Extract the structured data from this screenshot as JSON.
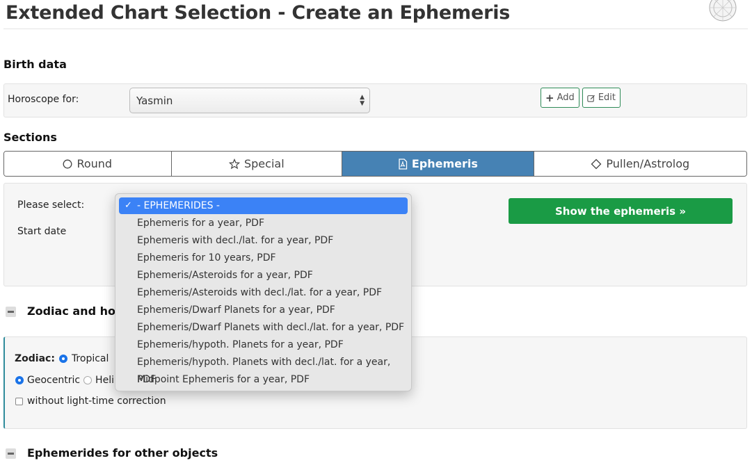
{
  "page": {
    "title": "Extended Chart Selection - Create an Ephemeris"
  },
  "birth": {
    "heading": "Birth data",
    "horoscope_label": "Horoscope for:",
    "horoscope_value": "Yasmin",
    "add_label": "Add",
    "edit_label": "Edit"
  },
  "sections": {
    "heading": "Sections",
    "tabs": [
      {
        "label": "Round",
        "icon": "circle-icon"
      },
      {
        "label": "Special",
        "icon": "star-icon"
      },
      {
        "label": "Ephemeris",
        "icon": "pdf-icon"
      },
      {
        "label": "Pullen/Astrolog",
        "icon": "diamond-icon"
      }
    ],
    "active_tab": "Ephemeris",
    "active_color": "#4682b4"
  },
  "form": {
    "please_select_label": "Please select:",
    "start_date_label": "Start date",
    "show_button": "Show the ephemeris »",
    "show_button_color": "#1a9b45"
  },
  "dropdown": {
    "selected": "- EPHEMERIDES -",
    "options": [
      "- EPHEMERIDES -",
      "Ephemeris for a year, PDF",
      "Ephemeris with decl./lat. for a year, PDF",
      "Ephemeris for 10 years, PDF",
      "Ephemeris/Asteroids for a year, PDF",
      "Ephemeris/Asteroids with decl./lat. for a year, PDF",
      "Ephemeris/Dwarf Planets for a year, PDF",
      "Ephemeris/Dwarf Planets with decl./lat. for a year, PDF",
      "Ephemeris/hypoth. Planets for a year, PDF",
      "Ephemeris/hypoth. Planets with decl./lat. for a year, PDF",
      "Midpoint Ephemeris for a year, PDF"
    ]
  },
  "zodiac": {
    "heading_visible": "Zodiac and hous",
    "zodiac_label": "Zodiac:",
    "tropical": "Tropical",
    "geocentric": "Geocentric",
    "helio_visible": "Heli",
    "light_time": "without light-time correction"
  },
  "other": {
    "heading": "Ephemerides for other objects"
  }
}
